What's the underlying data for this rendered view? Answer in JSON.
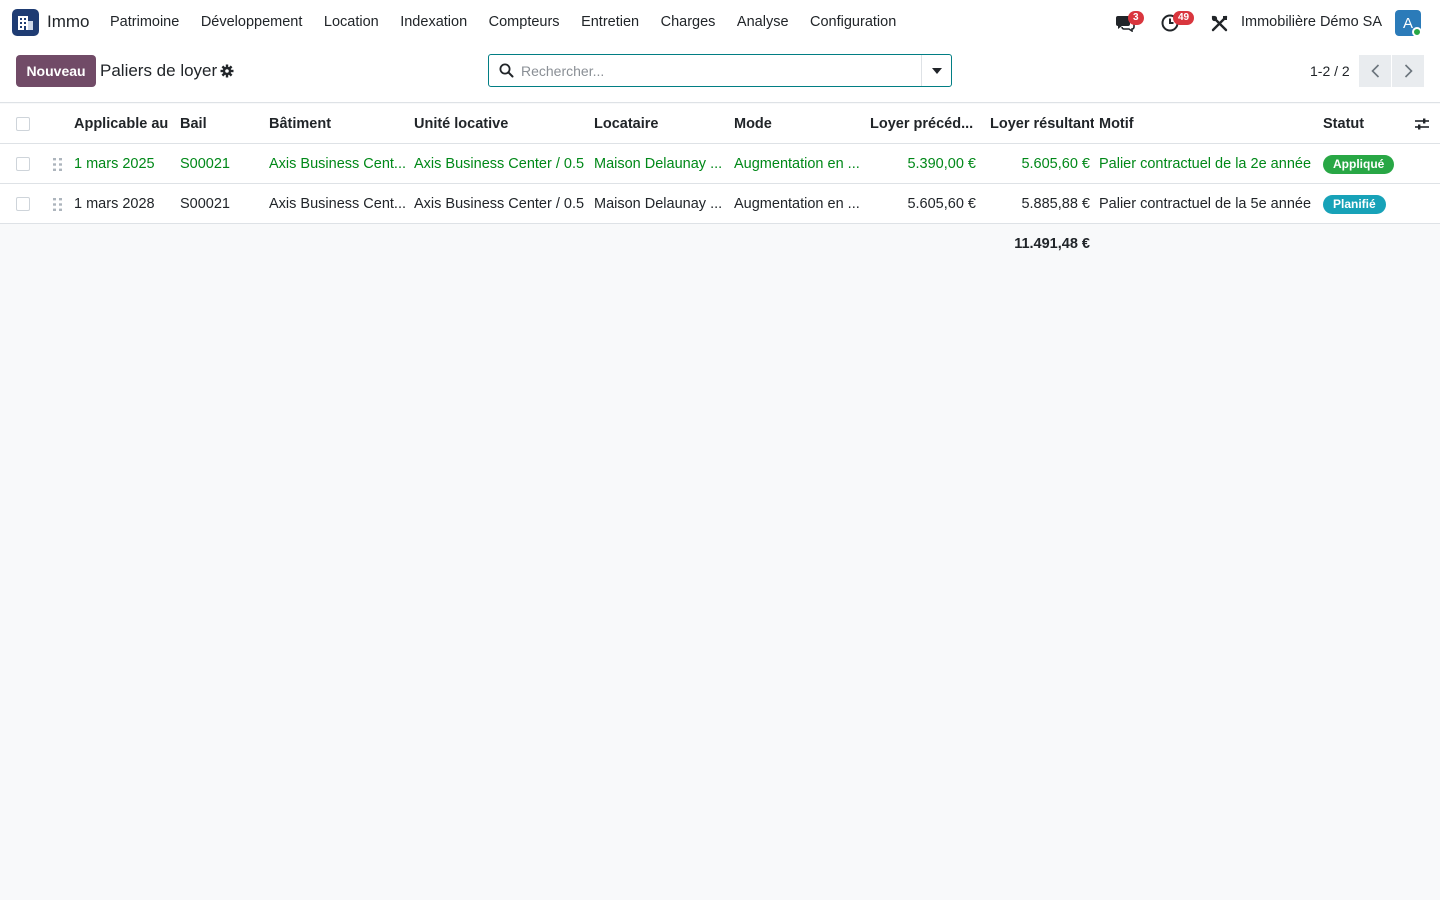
{
  "app": {
    "name": "Immo"
  },
  "menu": [
    "Patrimoine",
    "Développement",
    "Location",
    "Indexation",
    "Compteurs",
    "Entretien",
    "Charges",
    "Analyse",
    "Configuration"
  ],
  "systray": {
    "messages_count": "3",
    "activities_count": "49",
    "company": "Immobilière Démo SA",
    "avatar_initial": "A"
  },
  "control": {
    "new_label": "Nouveau",
    "title": "Paliers de loyer",
    "search_placeholder": "Rechercher...",
    "pager": "1-2 / 2"
  },
  "table": {
    "headers": {
      "date": "Applicable au",
      "lease": "Bail",
      "building": "Bâtiment",
      "unit": "Unité locative",
      "tenant": "Locataire",
      "mode": "Mode",
      "prev_rent": "Loyer précéd...",
      "new_rent": "Loyer résultant",
      "reason": "Motif",
      "status": "Statut"
    },
    "rows": [
      {
        "date": "1 mars 2025",
        "lease": "S00021",
        "building": "Axis Business Cent...",
        "unit": "Axis Business Center / 0.5",
        "tenant": "Maison Delaunay ...",
        "mode": "Augmentation en ...",
        "prev_rent": "5.390,00 €",
        "new_rent": "5.605,60 €",
        "reason": "Palier contractuel de la 2e année",
        "status": "Appliqué",
        "status_color": "#28a745",
        "text_color": "#008818"
      },
      {
        "date": "1 mars 2028",
        "lease": "S00021",
        "building": "Axis Business Cent...",
        "unit": "Axis Business Center / 0.5",
        "tenant": "Maison Delaunay ...",
        "mode": "Augmentation en ...",
        "prev_rent": "5.605,60 €",
        "new_rent": "5.885,88 €",
        "reason": "Palier contractuel de la 5e année",
        "status": "Planifié",
        "status_color": "#17a2b8",
        "text_color": "#212529"
      }
    ],
    "total_new_rent": "11.491,48 €"
  },
  "colors": {
    "brand": "#714b67",
    "accent": "#017e84",
    "applied_text": "#008818"
  }
}
